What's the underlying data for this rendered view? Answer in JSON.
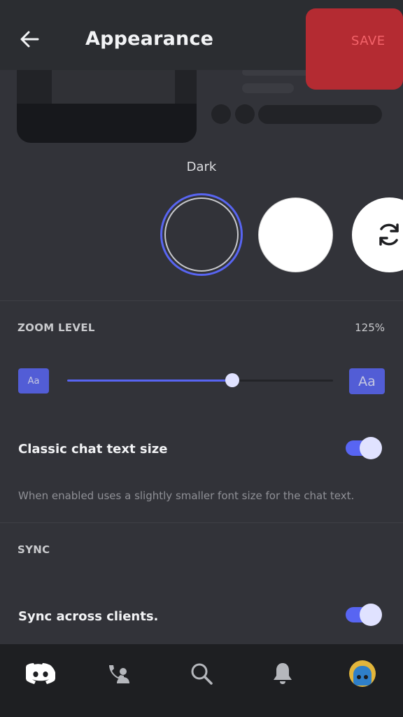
{
  "header": {
    "title": "Appearance",
    "save_label": "SAVE"
  },
  "theme": {
    "selected_label": "Dark",
    "options": [
      {
        "name": "Dark",
        "selected": true
      },
      {
        "name": "Light",
        "selected": false
      },
      {
        "name": "Sync",
        "selected": false
      }
    ]
  },
  "zoom": {
    "section_label": "ZOOM LEVEL",
    "value_text": "125%",
    "level_fraction": 0.62,
    "small_label": "Aa",
    "large_label": "Aa"
  },
  "classic_chat": {
    "title": "Classic chat text size",
    "description": "When enabled uses a slightly smaller font size for the chat text.",
    "enabled": true
  },
  "sync": {
    "section_label": "SYNC",
    "title": "Sync across clients.",
    "enabled": true
  },
  "bottom_nav": {
    "items": [
      "discord-home-icon",
      "friends-icon",
      "search-icon",
      "notifications-bell-icon",
      "profile-avatar"
    ]
  },
  "colors": {
    "accent": "#5865f2",
    "background": "#323339",
    "header": "#2b2d31",
    "nav": "#1e1f22",
    "save_highlight": "#b42b32"
  }
}
